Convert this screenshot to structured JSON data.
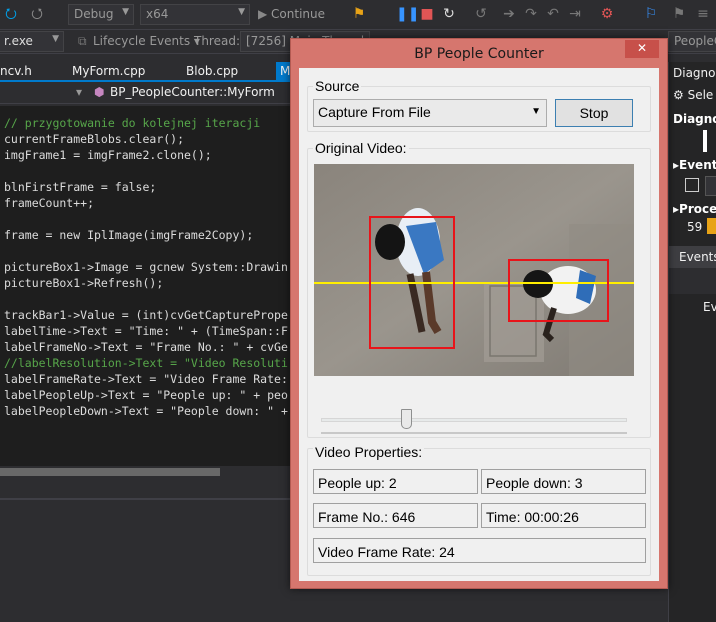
{
  "vs": {
    "config": "Debug",
    "platform": "x64",
    "continue_label": "Continue",
    "exe": "r.exe",
    "lifecycle": "Lifecycle Events",
    "thread_label": "Thread:",
    "thread_value": "[7256] Main Thread",
    "tabs": [
      "ncv.h",
      "MyForm.cpp",
      "Blob.cpp",
      "M"
    ],
    "nav_member": "BP_PeopleCounter::MyForm",
    "code_lines": [
      {
        "cls": "cm",
        "text": "// przygotowanie do kolejnej iteracji"
      },
      {
        "cls": "pl",
        "text": "currentFrameBlobs.clear();"
      },
      {
        "cls": "pl",
        "text": "imgFrame1 = imgFrame2.clone();"
      },
      {
        "cls": "pl",
        "text": ""
      },
      {
        "cls": "pl",
        "text": "blnFirstFrame = false;"
      },
      {
        "cls": "pl",
        "text": "frameCount++;"
      },
      {
        "cls": "pl",
        "text": ""
      },
      {
        "cls": "pl",
        "text": "frame = new IplImage(imgFrame2Copy);"
      },
      {
        "cls": "pl",
        "text": ""
      },
      {
        "cls": "pl",
        "text": "pictureBox1->Image = gcnew System::Drawin"
      },
      {
        "cls": "pl",
        "text": "pictureBox1->Refresh();"
      },
      {
        "cls": "pl",
        "text": ""
      },
      {
        "cls": "pl",
        "text": "trackBar1->Value = (int)cvGetCapturePrope"
      },
      {
        "cls": "pl",
        "text": "labelTime->Text = \"Time: \" + (TimeSpan::F"
      },
      {
        "cls": "pl",
        "text": "labelFrameNo->Text = \"Frame No.: \" + cvGe"
      },
      {
        "cls": "cm",
        "text": "//labelResolution->Text = \"Video Resoluti"
      },
      {
        "cls": "pl",
        "text": "labelFrameRate->Text = \"Video Frame Rate:"
      },
      {
        "cls": "pl",
        "text": "labelPeopleUp->Text = \"People up: \" + peo"
      },
      {
        "cls": "pl",
        "text": "labelPeopleDown->Text = \"People down: \" +"
      }
    ],
    "diag_title": "Diagnos",
    "diag_select": "Sele",
    "diag_head": "Diagno",
    "diag_events": "Event",
    "diag_process": "Proce",
    "diag_num": "59",
    "diag_events_tab": "Events",
    "diag_ev": "Ev"
  },
  "dialog": {
    "title": "BP People Counter",
    "close": "✕",
    "source_label": "Source",
    "source_select": "Capture From File",
    "stop_label": "Stop",
    "original_video_label": "Original Video:",
    "video_props_label": "Video Properties:",
    "people_up": "People up: 2",
    "people_down": "People down: 3",
    "frame_no": "Frame No.: 646",
    "time": "Time: 00:00:26",
    "frame_rate": "Video Frame Rate: 24",
    "trackbar_position": 0.27,
    "colors": {
      "bbox": "#e8141a",
      "count_line": "#ffee00",
      "title_bar": "#d6766e"
    }
  }
}
